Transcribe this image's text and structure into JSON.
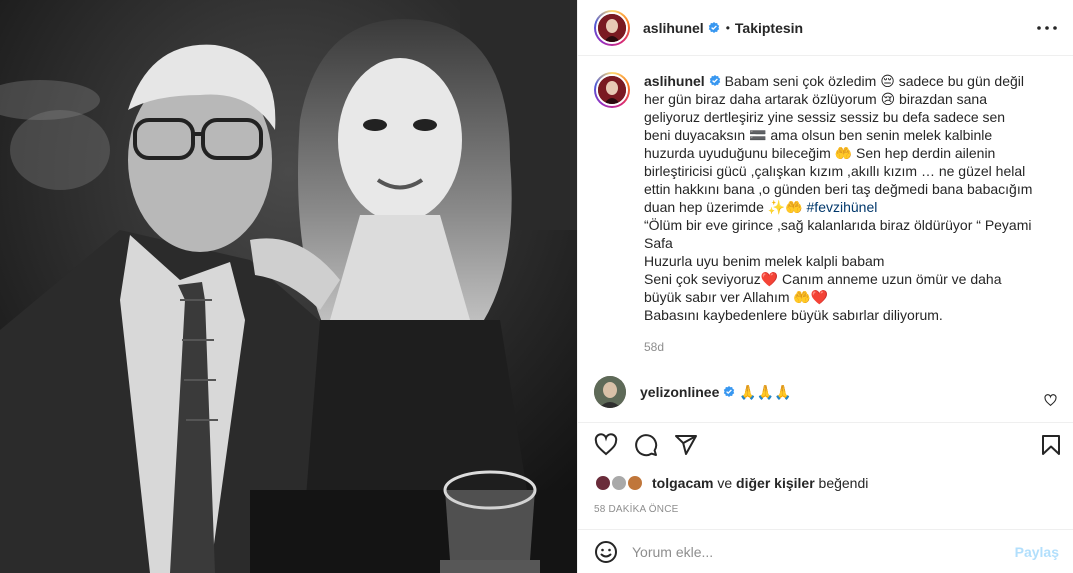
{
  "post": {
    "username": "aslihunel",
    "follow_state": "Takiptesin",
    "dot": "•",
    "caption": {
      "username": "aslihunel",
      "lines": [
        "Babam seni çok özledim 😔 sadece bu gün değil",
        "her gün biraz daha artarak özlüyorum 😢 birazdan sana",
        "geliyoruz dertleşiriz yine sessiz sessiz bu defa sadece sen",
        "beni duyacaksın 🟰 ama olsun ben senin melek kalbinle",
        "huzurda uyuduğunu bileceğim 🤲 Sen hep derdin ailenin",
        "birleştiricisi gücü ,çalışkan kızım ,akıllı kızım … ne güzel helal",
        "ettin hakkını bana ,o günden beri taş değmedi bana babacığım",
        "duan hep üzerimde ✨🤲"
      ],
      "hashtag": "#fevzihünel",
      "lines2": [
        "“Ölüm bir eve girince ,sağ kalanlarıda biraz öldürüyor “ Peyami",
        "Safa",
        "Huzurla uyu benim melek kalpli babam",
        "Seni çok seviyoruz❤️ Canım anneme uzun ömür ve daha",
        "büyük sabır ver Allahım 🤲❤️",
        "Babasını kaybedenlere büyük sabırlar diliyorum."
      ],
      "age": "58d"
    },
    "comment": {
      "username": "yelizonlinee",
      "text": "🙏🙏🙏"
    },
    "likes": {
      "first_liker": "tolgacam",
      "connector": "ve",
      "others": "diğer kişiler",
      "suffix": "beğendi"
    },
    "posted_ago": "58 DAKİKA ÖNCE",
    "add_comment": {
      "placeholder": "Yorum ekle...",
      "post_label": "Paylaş"
    }
  },
  "icons": {
    "verified": "verified-badge-icon",
    "more": "more-options-icon",
    "like": "heart-icon",
    "comment": "comment-icon",
    "share": "send-icon",
    "save": "bookmark-icon",
    "emoji": "emoji-smile-icon",
    "comment_like": "small-heart-icon"
  },
  "colors": {
    "verified": "#3897f0",
    "link": "#00376b",
    "muted": "#8e8e8e",
    "post_disabled": "#b2dffc",
    "border": "#efefef"
  }
}
